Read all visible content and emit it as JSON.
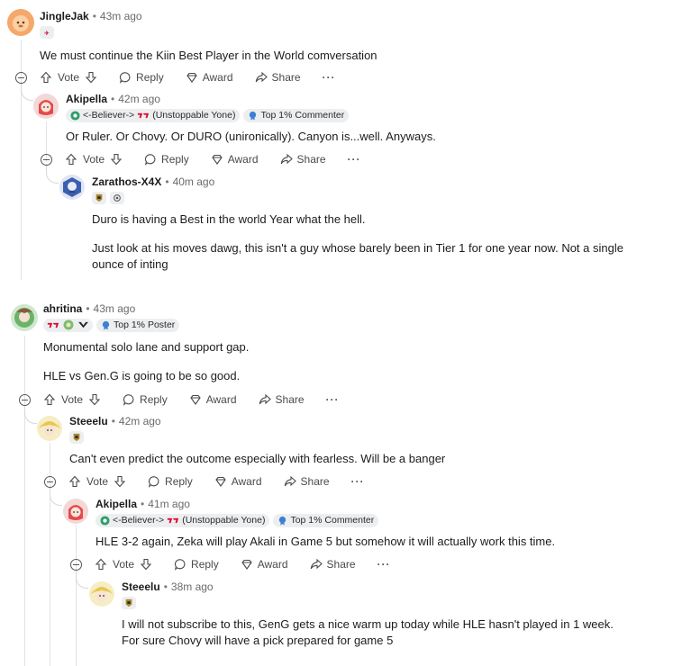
{
  "actions": {
    "vote": "Vote",
    "reply": "Reply",
    "award": "Award",
    "share": "Share",
    "more": "···"
  },
  "comments": [
    {
      "author": "JingleJak",
      "time": "43m ago",
      "body": [
        "We must continue the Kiin Best Player in the World comversation"
      ],
      "avatar_color": "#f5a86b"
    },
    {
      "author": "Akipella",
      "time": "42m ago",
      "flair_text": "<-Believer->",
      "flair_text2": "(Unstoppable Yone)",
      "top_badge": "Top 1% Commenter",
      "body": [
        "Or Ruler. Or Chovy. Or DURO (unironically). Canyon is...well. Anyways."
      ],
      "avatar_color": "#e24b4b"
    },
    {
      "author": "Zarathos-X4X",
      "time": "40m ago",
      "body": [
        "Duro is having a Best in the world Year what the hell.",
        "Just look at his moves dawg, this isn't a guy whose barely been in Tier 1 for one year now. Not a single ounce of inting"
      ],
      "avatar_color": "#3b5fb0"
    },
    {
      "author": "ahritina",
      "time": "43m ago",
      "top_badge": "Top 1% Poster",
      "body": [
        "Monumental solo lane and support gap.",
        "HLE vs Gen.G is going to be so good."
      ],
      "avatar_color": "#6cb36a"
    },
    {
      "author": "Steeelu",
      "time": "42m ago",
      "body": [
        "Can't even predict the outcome especially with fearless. Will be a banger"
      ],
      "avatar_color": "#e8c84a"
    },
    {
      "author": "Akipella",
      "time": "41m ago",
      "flair_text": "<-Believer->",
      "flair_text2": "(Unstoppable Yone)",
      "top_badge": "Top 1% Commenter",
      "body": [
        "HLE 3-2 again, Zeka will play Akali in Game 5 but somehow it will actually work this time."
      ],
      "avatar_color": "#e24b4b"
    },
    {
      "author": "Steeelu",
      "time": "38m ago",
      "body": [
        "I will not subscribe to this, GenG gets a nice warm up today while HLE hasn't played in 1 week.",
        "For sure Chovy will have a pick prepared for game 5"
      ],
      "avatar_color": "#e8c84a"
    }
  ],
  "colors": {
    "t1_red": "#e2012d",
    "geng_gold": "#a88a2e",
    "believer_green": "#2e9e6a",
    "top_badge_blue": "#3d7fd6"
  }
}
